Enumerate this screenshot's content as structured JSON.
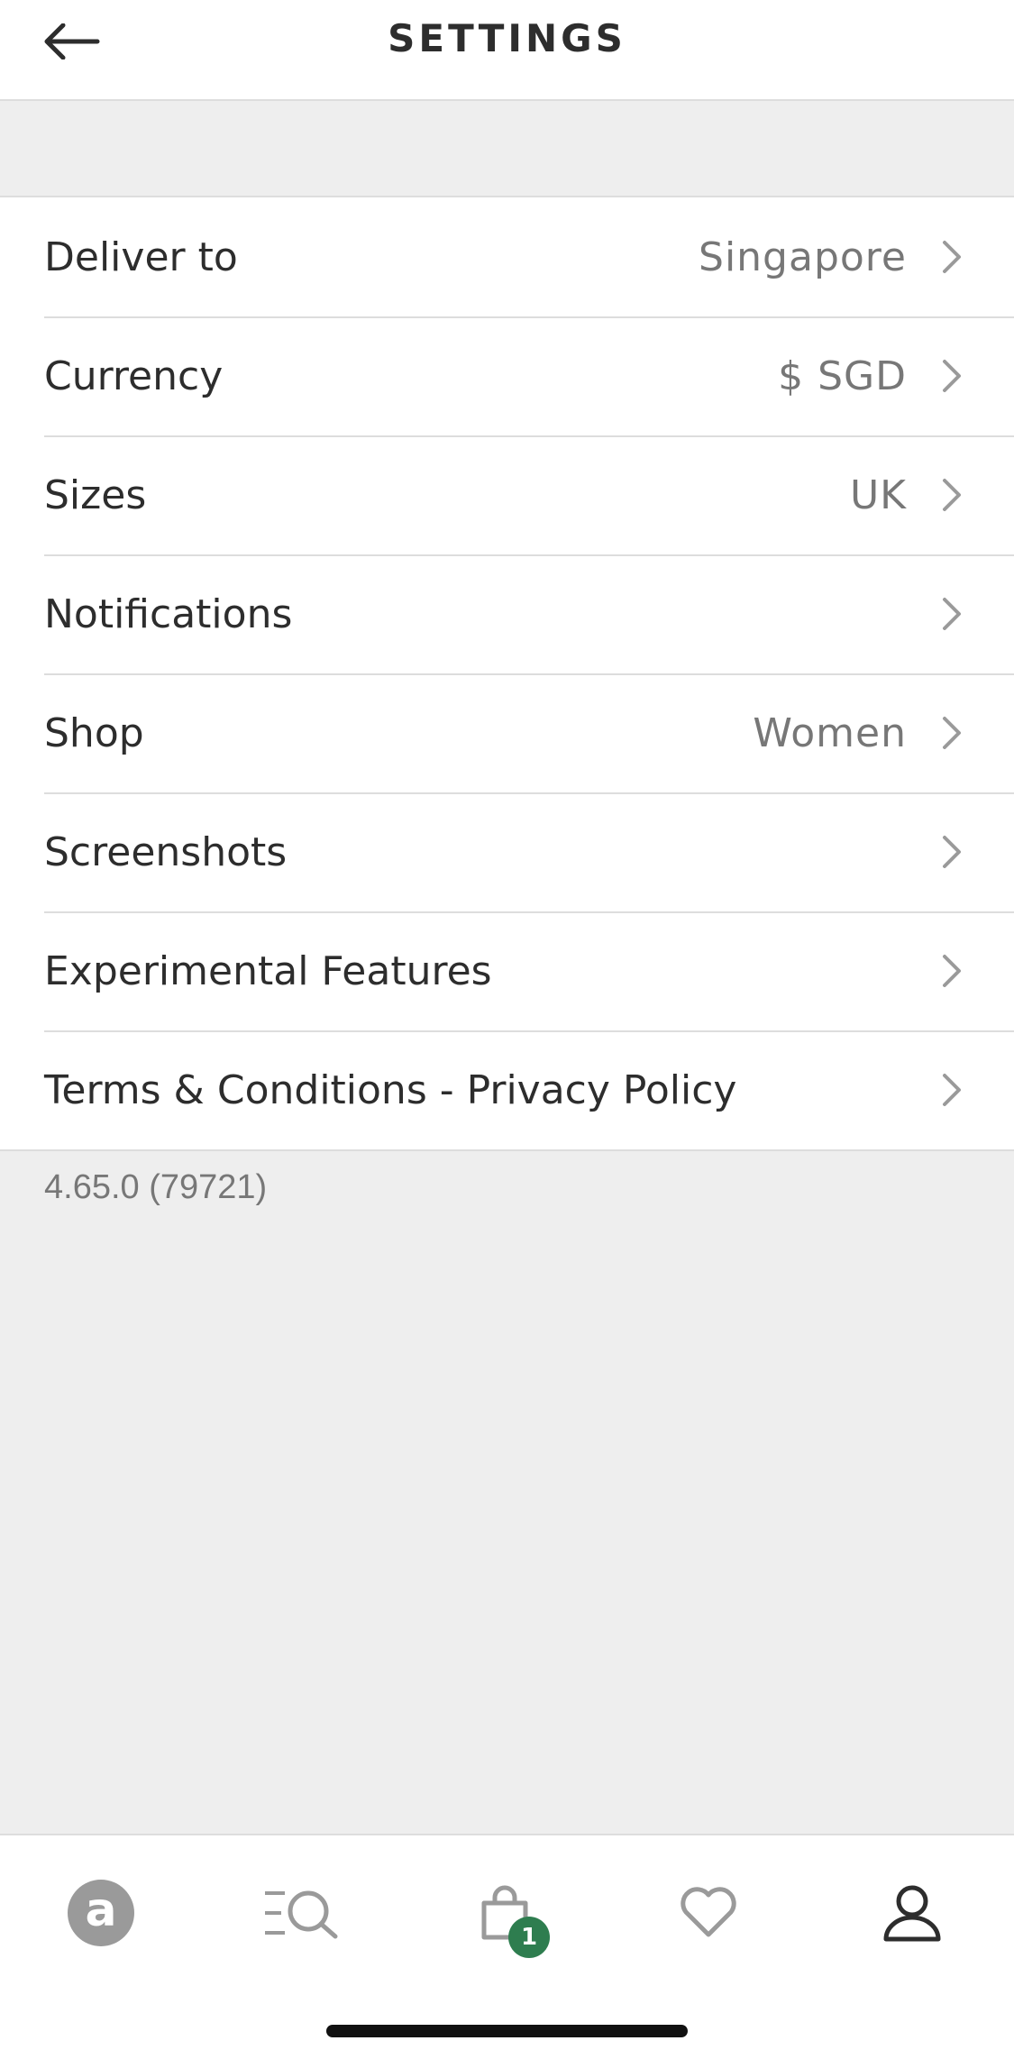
{
  "header": {
    "title": "SETTINGS",
    "back_icon": "arrow-left-icon"
  },
  "settings": {
    "items": [
      {
        "label": "Deliver to",
        "value": "Singapore"
      },
      {
        "label": "Currency",
        "value": "$ SGD"
      },
      {
        "label": "Sizes",
        "value": "UK"
      },
      {
        "label": "Notifications",
        "value": ""
      },
      {
        "label": "Shop",
        "value": "Women"
      },
      {
        "label": "Screenshots",
        "value": ""
      },
      {
        "label": "Experimental Features",
        "value": ""
      },
      {
        "label": "Terms & Conditions - Privacy Policy",
        "value": ""
      }
    ],
    "chevron_icon": "chevron-right-icon"
  },
  "version": "4.65.0 (79721)",
  "tabbar": {
    "home_logo_letter": "a",
    "bag_count": "1",
    "icons": [
      "home-logo-icon",
      "search-menu-icon",
      "bag-icon",
      "heart-icon",
      "account-icon"
    ],
    "active_tab": "account"
  },
  "colors": {
    "background": "#eeeeee",
    "surface": "#ffffff",
    "text": "#2d2d2d",
    "secondary_text": "#777777",
    "badge": "#2e7d4f",
    "divider": "#dddddd"
  }
}
